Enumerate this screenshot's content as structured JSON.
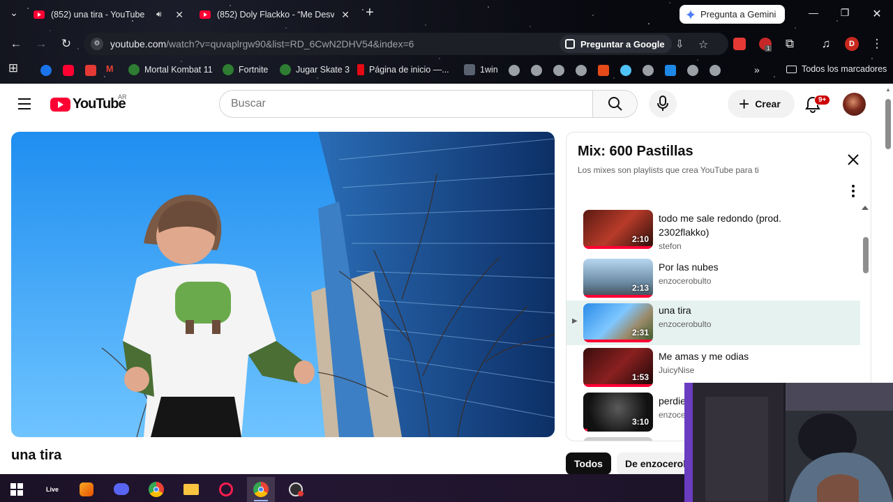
{
  "browser": {
    "tabs": [
      {
        "title": "(852) una tira - YouTube",
        "audio": true
      },
      {
        "title": "(852) Doly Flackko - “Me Desve"
      }
    ],
    "gemini_button": "Pregunta a Gemini",
    "url_host": "youtube.com",
    "url_path": "/watch?v=quvaplrgw90&list=RD_6CwN2DHV54&index=6",
    "ask_google": "Preguntar a Google",
    "profile_letter": "D",
    "extension_badge": "1",
    "bookmarks": [
      "Mortal Kombat 11",
      "Fortnite",
      "Jugar Skate 3",
      "Página de inicio —...",
      "1win"
    ],
    "all_bookmarks": "Todos los marcadores",
    "accent": "#ff0033"
  },
  "youtube": {
    "logo_text": "YouTube",
    "country_code": "AR",
    "search_placeholder": "Buscar",
    "create_label": "Crear",
    "notification_count": "9+",
    "video_title": "una tira",
    "playlist": {
      "title": "Mix: 600 Pastillas",
      "subtitle": "Los mixes son playlists que crea YouTube para ti",
      "items": [
        {
          "title": "todo me sale redondo (prod. 2302flakko)",
          "channel": "stefon",
          "duration": "2:10"
        },
        {
          "title": "Por las nubes",
          "channel": "enzocerobulto",
          "duration": "2:13"
        },
        {
          "title": "una tira",
          "channel": "enzocerobulto",
          "duration": "2:31",
          "playing": true
        },
        {
          "title": "Me amas y me odias",
          "channel": "JuicyNise",
          "duration": "1:53"
        },
        {
          "title": "perdie",
          "channel": "enzoce",
          "duration": "3:10"
        }
      ]
    },
    "chips": [
      "Todos",
      "De enzocerob"
    ]
  },
  "taskbar": {
    "live_label": "Live",
    "apps": [
      "windows-start",
      "live",
      "fl-studio",
      "discord",
      "chrome",
      "file-explorer",
      "opera-gx",
      "chrome-profile",
      "obs"
    ]
  }
}
